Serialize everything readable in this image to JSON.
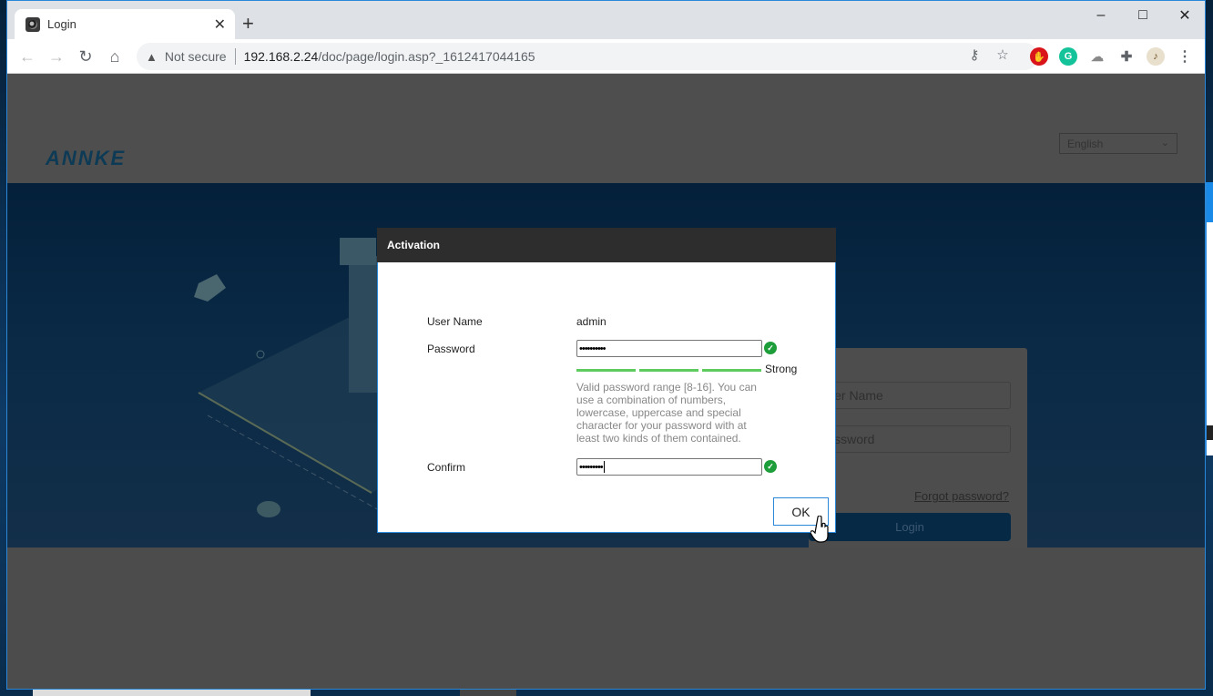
{
  "browser": {
    "tab": {
      "title": "Login",
      "favicon": "camera-icon"
    },
    "new_tab_label": "+",
    "window_controls": {
      "minimize": "–",
      "maximize": "□",
      "close": "✕"
    },
    "address_bar": {
      "security_label": "Not secure",
      "url_host": "192.168.2.24",
      "url_path": "/doc/page/login.asp?_1612417044165"
    },
    "extensions": [
      "key-icon",
      "star-icon",
      "adblock-icon",
      "grammarly-icon",
      "extension-cloud-icon",
      "puzzle-icon",
      "profile-avatar",
      "menu-icon"
    ]
  },
  "page": {
    "logo": "ANNKE",
    "language_select": {
      "selected": "English"
    },
    "login_form": {
      "username_placeholder": "User Name",
      "password_placeholder": "Password",
      "forgot_link": "Forgot password?",
      "login_button": "Login"
    }
  },
  "activation_dialog": {
    "title": "Activation",
    "username_label": "User Name",
    "username_value": "admin",
    "password_label": "Password",
    "password_value": "••••••••••",
    "password_valid": true,
    "strength_label": "Strong",
    "strength_segments_filled": 3,
    "strength_segments_total": 3,
    "strength_color": "#5dcb5d",
    "hint": "Valid password range [8-16]. You can use a combination of numbers, lowercase, uppercase and special character for your password with at least two kinds of them contained.",
    "confirm_label": "Confirm",
    "confirm_value": "•••••••••",
    "confirm_valid": true,
    "ok_button": "OK"
  }
}
